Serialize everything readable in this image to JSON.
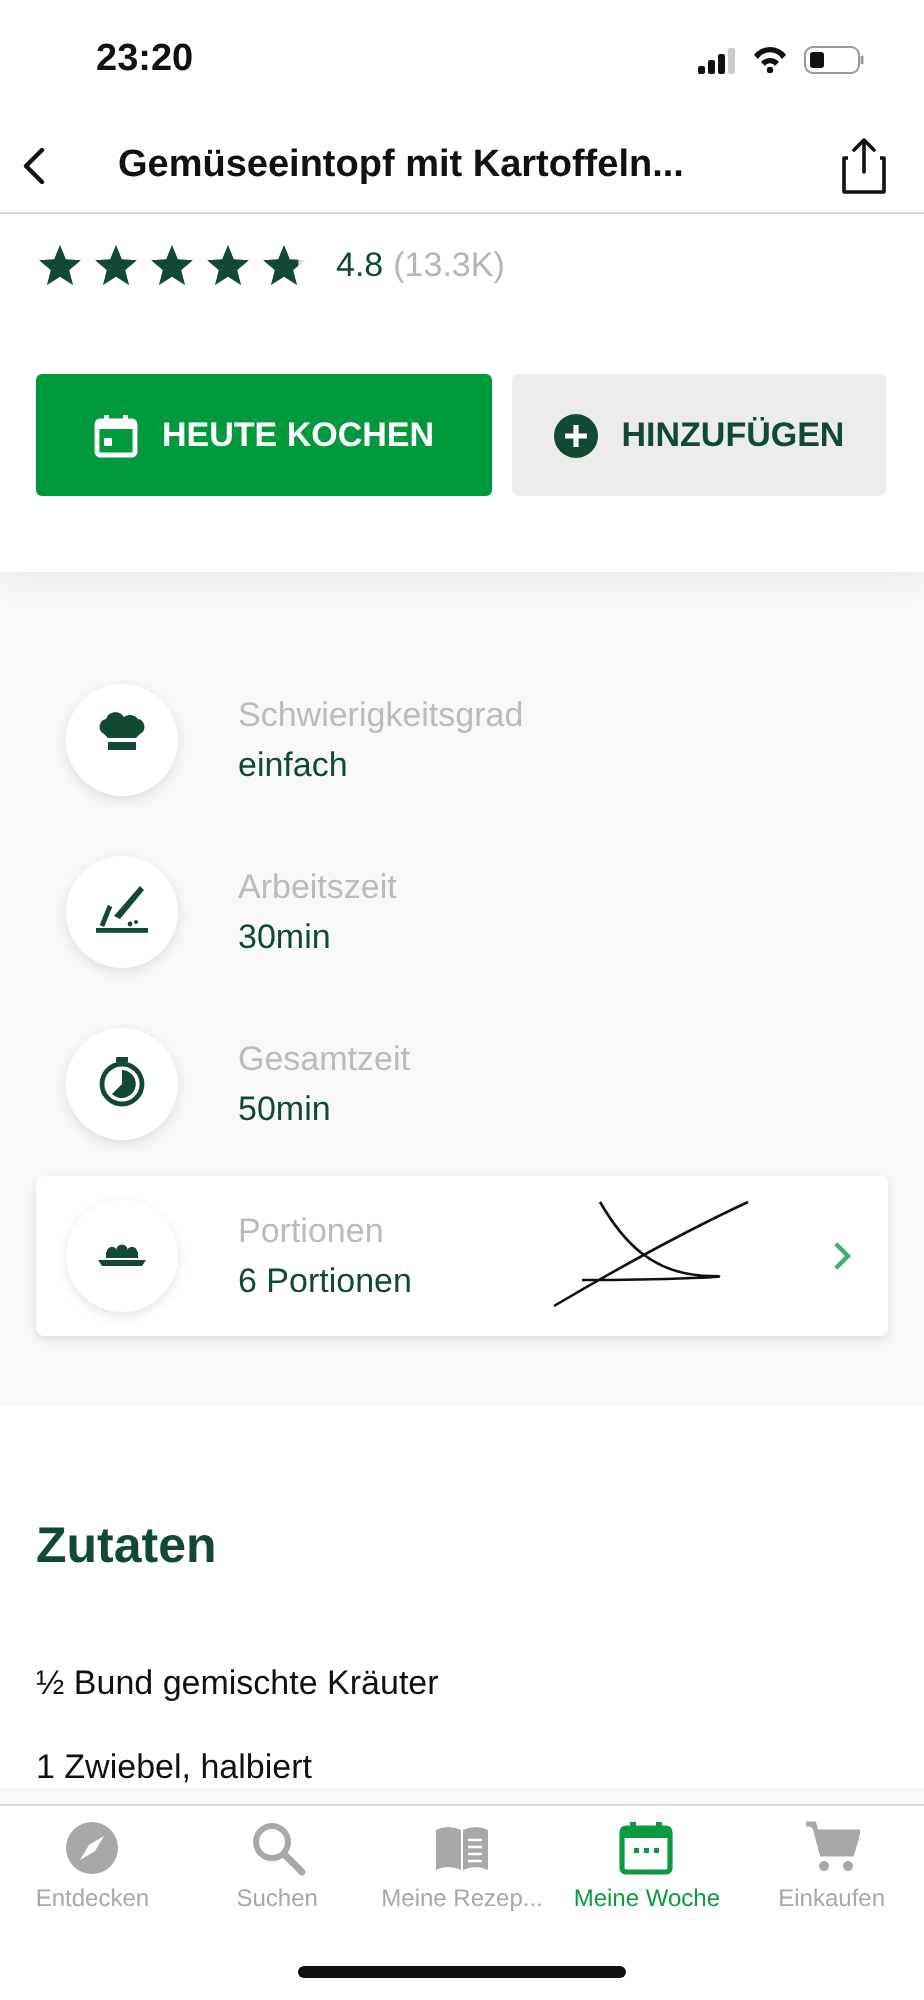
{
  "status_bar": {
    "time": "23:20"
  },
  "nav_bar": {
    "title": "Gemüseeintopf mit Kartoffeln..."
  },
  "rating": {
    "stars": 4.8,
    "value": "4.8",
    "count": "(13.3K)"
  },
  "actions": [
    {
      "kind": "primary",
      "label": "HEUTE KOCHEN"
    },
    {
      "kind": "secondary",
      "label": "HINZUFÜGEN"
    }
  ],
  "details": [
    {
      "kind": "difficulty",
      "label": "Schwierigkeitsgrad",
      "value": "einfach",
      "tappable": false
    },
    {
      "kind": "prep",
      "label": "Arbeitszeit",
      "value": "30min",
      "tappable": false
    },
    {
      "kind": "total",
      "label": "Gesamtzeit",
      "value": "50min",
      "tappable": false
    },
    {
      "kind": "servings",
      "label": "Portionen",
      "value": "6 Portionen",
      "tappable": true
    }
  ],
  "ingredients": {
    "title": "Zutaten",
    "items": [
      "½ Bund gemischte Kräuter",
      "1 Zwiebel, halbiert"
    ]
  },
  "tab_bar": [
    {
      "label": "Entdecken",
      "selected": false
    },
    {
      "label": "Suchen",
      "selected": false
    },
    {
      "label": "Meine Rezep...",
      "selected": false
    },
    {
      "label": "Meine Woche",
      "selected": true
    },
    {
      "label": "Einkaufen",
      "selected": false
    }
  ]
}
